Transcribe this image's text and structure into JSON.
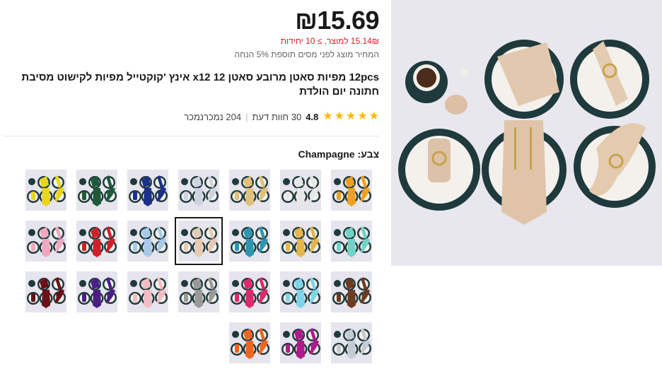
{
  "product": {
    "price": "₪15.69",
    "bulk_price": "15.14₪ למוצר, ≥ 10 יחידות",
    "tax_note": "המחיר מוצג לפני מסים תוספת 5% הנחה",
    "title": "12pcs מפיות סאטן מרובע סאטן 12 x12 אינץ 'קוקטייל מפיות לקישוט מסיבת חתונה יום הולדת",
    "rating": "4.8",
    "stars": 5,
    "reviews": "30 חוות דעת",
    "sold": "204 נמכרנמכר",
    "image_icon": "product-image"
  },
  "color": {
    "label": "צבע:",
    "selected": "Champagne"
  },
  "swatches": [
    {
      "color": "#f0a020"
    },
    {
      "color": "#e7e7e7"
    },
    {
      "color": "#e2c07a"
    },
    {
      "color": "#cfd4e0"
    },
    {
      "color": "#1b2f8c"
    },
    {
      "color": "#1e5a3a"
    },
    {
      "color": "#e8d51c"
    },
    {
      "color": "#6fd3c8"
    },
    {
      "color": "#e3b54a"
    },
    {
      "color": "#2c96b0"
    },
    {
      "color": "#e6cbb4"
    },
    {
      "color": "#a7c9ea"
    },
    {
      "color": "#d0202a"
    },
    {
      "color": "#f0a8c0"
    },
    {
      "color": "#6b3b22"
    },
    {
      "color": "#7fd4ea"
    },
    {
      "color": "#e0286c"
    },
    {
      "color": "#9a9a98"
    },
    {
      "color": "#f3bcc4"
    },
    {
      "color": "#4b1e86"
    },
    {
      "color": "#6a1018"
    },
    {
      "color": "#c4cbd2"
    },
    {
      "color": "#b0198c"
    },
    {
      "color": "#f06420"
    }
  ]
}
